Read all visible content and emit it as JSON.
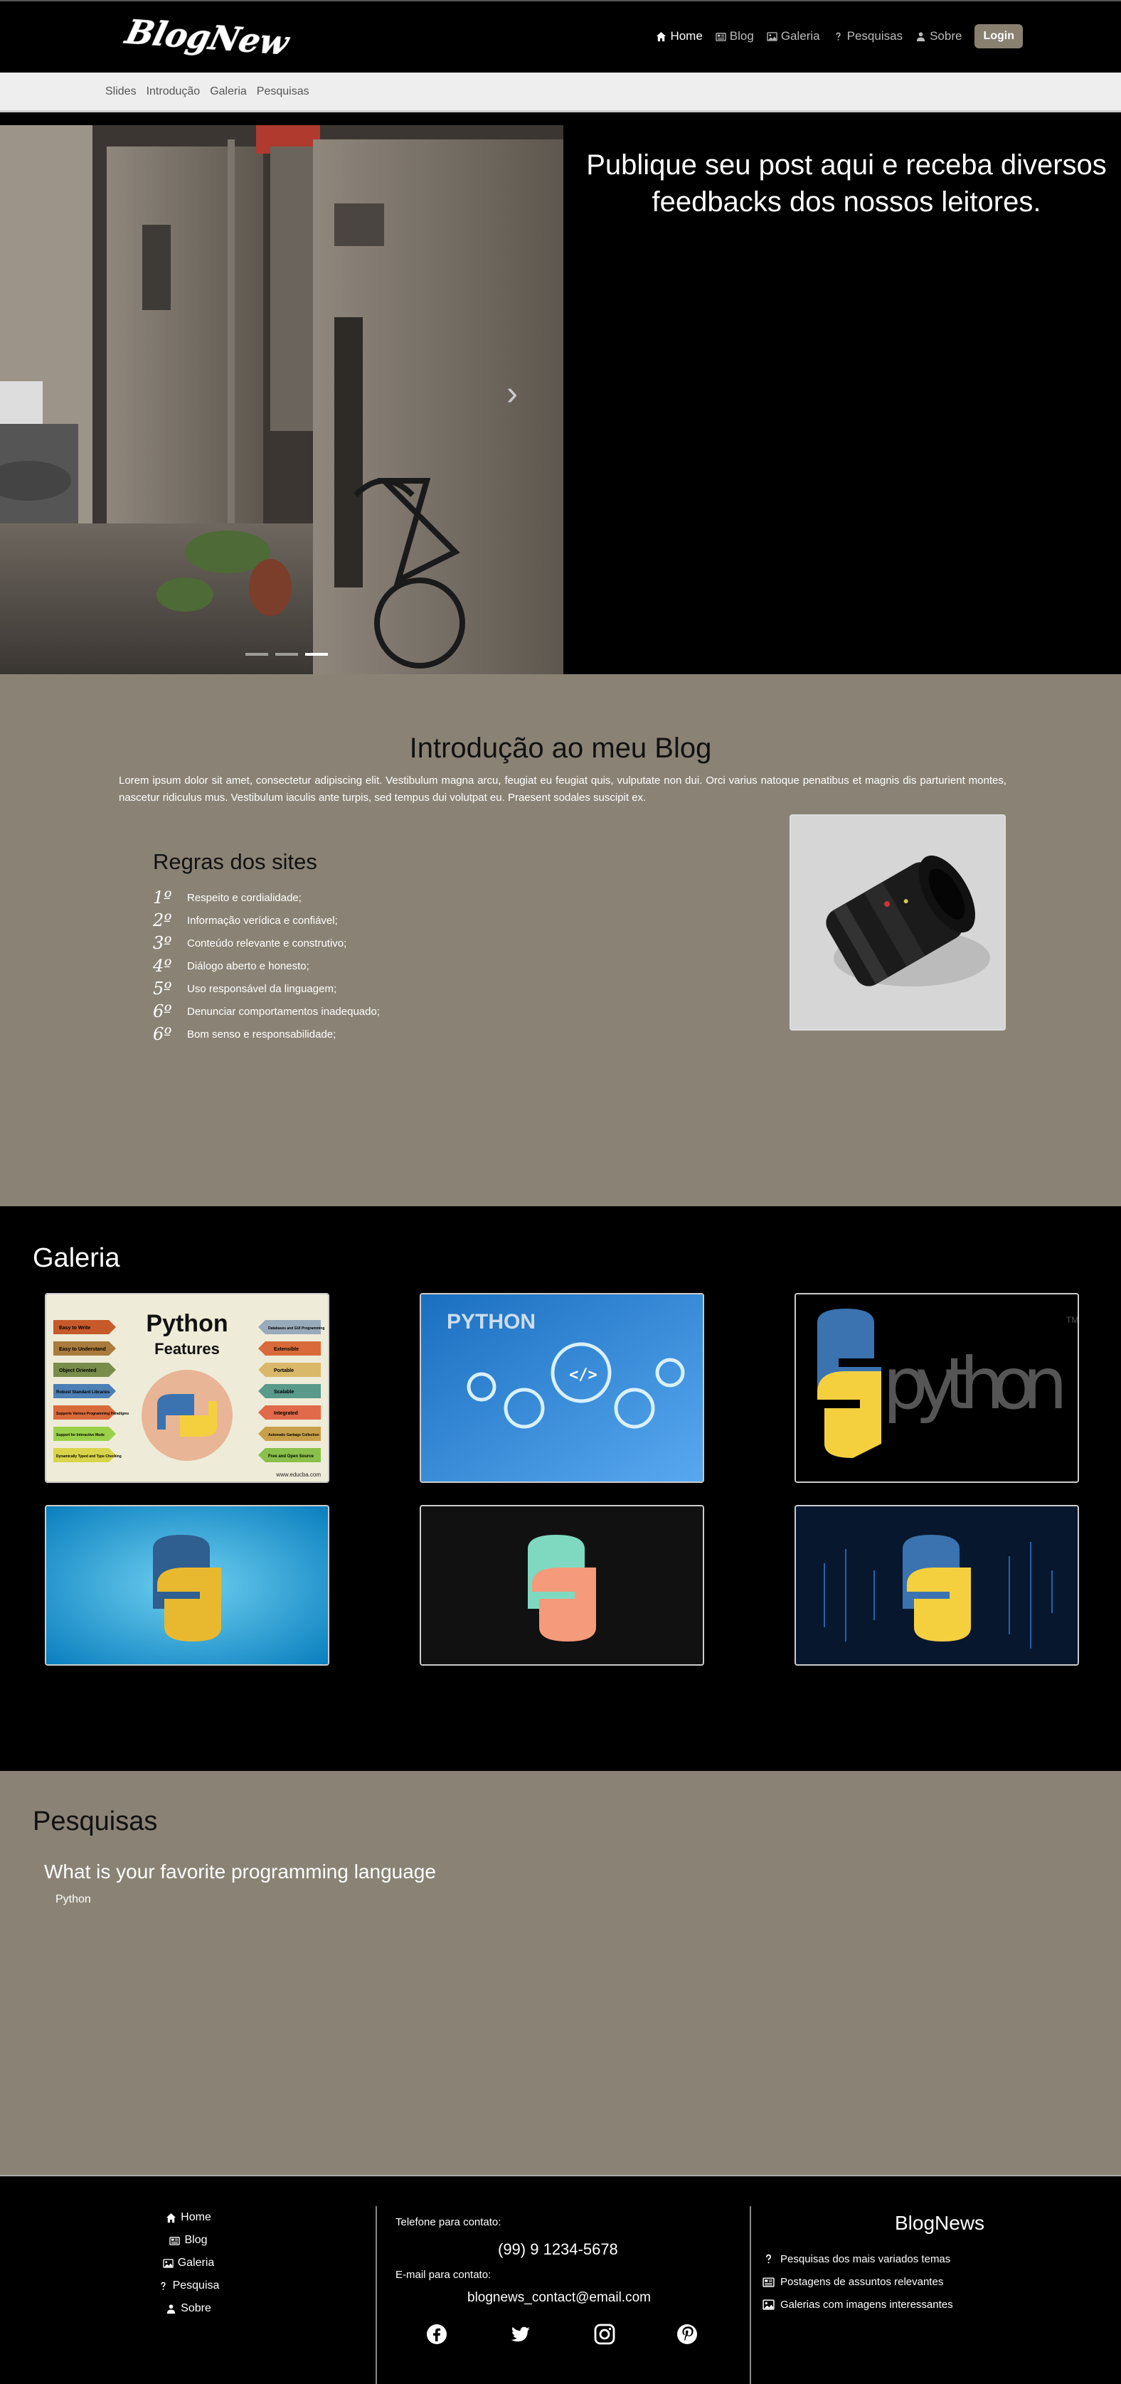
{
  "brand": {
    "logo_text": "BlogNew"
  },
  "nav": {
    "items": [
      {
        "label": "Home",
        "icon": "house-icon"
      },
      {
        "label": "Blog",
        "icon": "newspaper-icon"
      },
      {
        "label": "Galeria",
        "icon": "image-icon"
      },
      {
        "label": "Pesquisas",
        "icon": "question-icon"
      },
      {
        "label": "Sobre",
        "icon": "person-icon"
      }
    ],
    "login_label": "Login"
  },
  "subnav": {
    "items": [
      "Slides",
      "Introdução",
      "Galeria",
      "Pesquisas"
    ]
  },
  "hero": {
    "caption": "Publique seu post aqui e receba diversos feedbacks dos nossos leitores.",
    "arrow": "›",
    "active_slide": 3,
    "slide_count": 3
  },
  "intro": {
    "title": "Introdução ao meu Blog",
    "text": "Lorem ipsum dolor sit amet, consectetur adipiscing elit. Vestibulum magna arcu, feugiat eu feugiat quis, vulputate non dui. Orci varius natoque penatibus et magnis dis parturient montes, nascetur ridiculus mus. Vestibulum iaculis ante turpis, sed tempus dui volutpat eu. Praesent sodales suscipit ex.",
    "rules_title": "Regras dos sites",
    "rules": [
      {
        "num": "1º",
        "text": "Respeito e cordialidade;"
      },
      {
        "num": "2º",
        "text": "Informação verídica e confiável;"
      },
      {
        "num": "3º",
        "text": "Conteúdo relevante e construtivo;"
      },
      {
        "num": "4º",
        "text": "Diálogo aberto e honesto;"
      },
      {
        "num": "5º",
        "text": "Uso responsável da linguagem;"
      },
      {
        "num": "6º",
        "text": "Denunciar comportamentos inadequado;"
      },
      {
        "num": "6º",
        "text": "Bom senso e responsabilidade;"
      }
    ]
  },
  "gallery": {
    "title": "Galeria",
    "img1": {
      "title": "Python",
      "subtitle": "Features",
      "left_tags": [
        "Easy to Write",
        "Easy to Understand",
        "Object Oriented",
        "Robust Standard Libraries",
        "Supports Various Programming Paradigms",
        "Support for Interactive Mode",
        "Dynamically Typed and Type Checking"
      ],
      "right_tags": [
        "Databases and GUI Programming",
        "Extensible",
        "Portable",
        "Scalable",
        "Integrated",
        "Automatic Garbage Collection",
        "Free and Open Source"
      ],
      "credit": "www.educba.com"
    },
    "img2": {
      "title": "PYTHON"
    },
    "img3": {
      "wordmark": "python",
      "tm": "TM"
    }
  },
  "survey": {
    "title": "Pesquisas",
    "question": "What is your favorite programming language",
    "option": "Python"
  },
  "footer": {
    "nav": [
      {
        "label": "Home",
        "icon": "house-icon"
      },
      {
        "label": "Blog",
        "icon": "newspaper-icon"
      },
      {
        "label": "Galeria",
        "icon": "image-icon"
      },
      {
        "label": "Pesquisa",
        "icon": "question-icon"
      },
      {
        "label": "Sobre",
        "icon": "person-icon"
      }
    ],
    "phone_label": "Telefone para contato:",
    "phone": "(99) 9 1234-5678",
    "email_label": "E-mail para contato:",
    "email": "blognews_contact@email.com",
    "social": [
      "facebook-icon",
      "twitter-icon",
      "instagram-icon",
      "pinterest-icon"
    ],
    "brand": "BlogNews",
    "features": [
      {
        "label": "Pesquisas dos mais variados temas",
        "icon": "question-icon"
      },
      {
        "label": "Postagens de assuntos relevantes",
        "icon": "newspaper-icon"
      },
      {
        "label": "Galerias com imagens interessantes",
        "icon": "image-icon"
      }
    ]
  }
}
